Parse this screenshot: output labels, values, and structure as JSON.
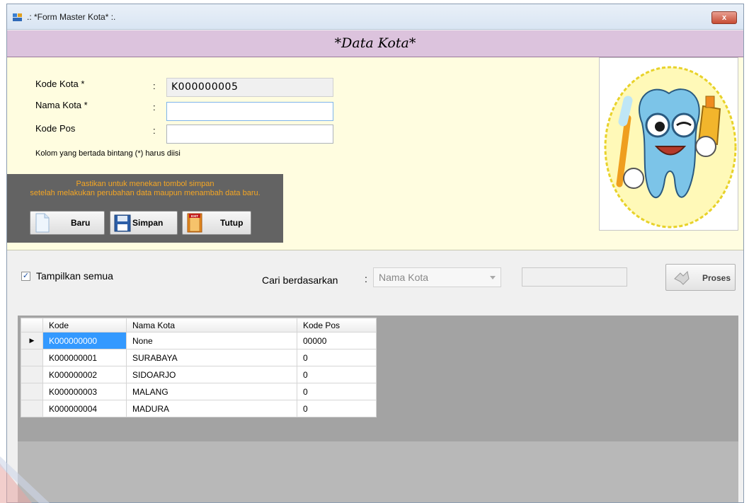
{
  "window": {
    "title": ".: *Form Master Kota* :.",
    "close_label": "x"
  },
  "header": {
    "title": "*Data Kota*"
  },
  "form": {
    "kode_label": "Kode Kota *",
    "kode_value": "K000000005",
    "nama_label": "Nama Kota *",
    "nama_value": "",
    "pos_label": "Kode Pos",
    "pos_value": "",
    "colon": ":",
    "note": "Kolom yang bertada bintang (*) harus diisi"
  },
  "panel": {
    "message_line1": "Pastikan untuk menekan tombol simpan",
    "message_line2": "setelah melakukan perubahan data maupun menambah data baru.",
    "btn_baru": "Baru",
    "btn_simpan": "Simpan",
    "btn_tutup": "Tutup",
    "exit_text": "EXIT"
  },
  "search": {
    "show_all_label": "Tampilkan semua",
    "show_all_checked": true,
    "search_by_label": "Cari berdasarkan",
    "colon": ":",
    "search_by_value": "Nama Kota",
    "search_text": "",
    "proses_label": "Proses"
  },
  "grid": {
    "columns": [
      "Kode",
      "Nama Kota",
      "Kode Pos"
    ],
    "rows": [
      {
        "kode": "K000000000",
        "nama": "None",
        "pos": "00000"
      },
      {
        "kode": "K000000001",
        "nama": "SURABAYA",
        "pos": "0"
      },
      {
        "kode": "K000000002",
        "nama": "SIDOARJO",
        "pos": "0"
      },
      {
        "kode": "K000000003",
        "nama": "MALANG",
        "pos": "0"
      },
      {
        "kode": "K000000004",
        "nama": "MADURA",
        "pos": "0"
      }
    ],
    "current_row_indicator": "▶"
  },
  "colors": {
    "header_bg": "#dcc3dd",
    "form_bg": "#fffde0",
    "panel_bg": "#636363",
    "panel_text": "#f5a623",
    "selection": "#3399ff"
  },
  "icons": [
    "app-icon",
    "close-icon",
    "new-file-icon",
    "save-disk-icon",
    "exit-door-icon",
    "proses-icon",
    "tooth-mascot-logo"
  ]
}
